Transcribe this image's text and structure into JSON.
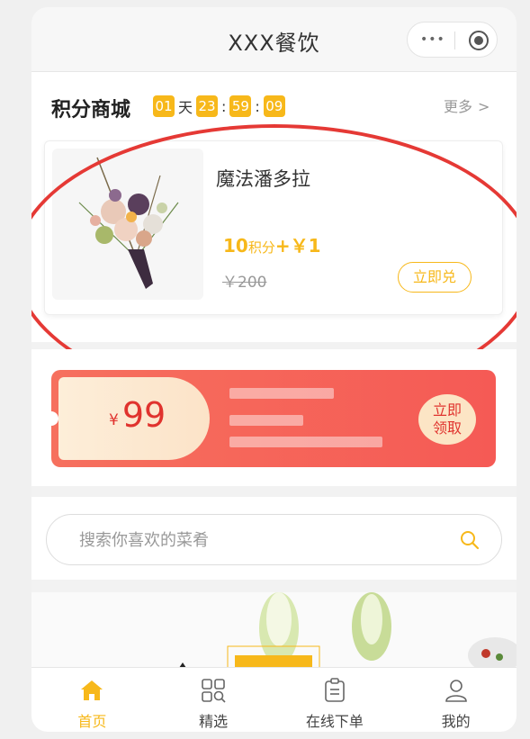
{
  "header": {
    "title": "XXX餐饮",
    "menu_glyph": "•••"
  },
  "mall": {
    "title": "积分商城",
    "countdown": {
      "days": "01",
      "day_unit": "天",
      "hours": "23",
      "minutes": "59",
      "seconds": "09",
      "separator": ":"
    },
    "more_label": "更多",
    "more_chevron": ">",
    "product": {
      "name": "魔法潘多拉",
      "price_points": "10",
      "points_unit": "积分",
      "price_plus": "+",
      "price_cash": "￥1",
      "original_price": "￥200",
      "redeem_label": "立即兑"
    }
  },
  "coupon": {
    "currency": "¥",
    "amount": "99",
    "claim_line1": "立即",
    "claim_line2": "领取"
  },
  "search": {
    "placeholder": "搜索你喜欢的菜肴"
  },
  "tabbar": {
    "items": [
      {
        "label": "首页",
        "icon": "home-icon",
        "active": true
      },
      {
        "label": "精选",
        "icon": "grid-search-icon",
        "active": false
      },
      {
        "label": "在线下单",
        "icon": "clipboard-icon",
        "active": false
      },
      {
        "label": "我的",
        "icon": "user-icon",
        "active": false
      }
    ]
  },
  "colors": {
    "accent": "#f7b81a",
    "coupon_red": "#f55a55",
    "annotation_red": "#e53935"
  }
}
